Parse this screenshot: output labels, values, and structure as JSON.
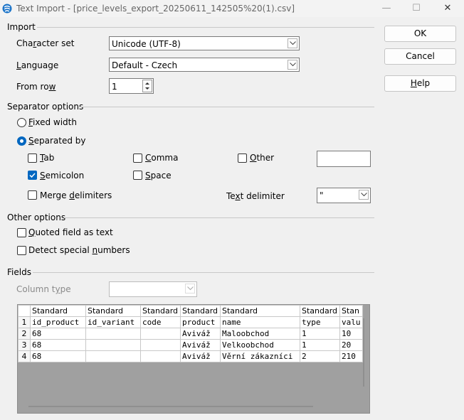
{
  "window": {
    "title": "Text Import - [price_levels_export_20250611_142505%20(1).csv]",
    "minimize": "—",
    "maximize": "☐",
    "close": "✕"
  },
  "import": {
    "section": "Import",
    "charset_label": "Character set",
    "charset_value": "Unicode (UTF-8)",
    "language_label": "Language",
    "language_value": "Default - Czech",
    "from_row_label": "From row",
    "from_row_value": "1"
  },
  "separator": {
    "section": "Separator options",
    "fixed_width": "Fixed width",
    "separated_by": "Separated by",
    "tab": "Tab",
    "comma": "Comma",
    "other": "Other",
    "semicolon": "Semicolon",
    "space": "Space",
    "merge": "Merge delimiters",
    "text_delim_label": "Text delimiter",
    "text_delim_value": "\""
  },
  "other_options": {
    "section": "Other options",
    "quoted": "Quoted field as text",
    "detect": "Detect special numbers"
  },
  "fields": {
    "section": "Fields",
    "column_type_label": "Column type",
    "column_type_value": ""
  },
  "buttons": {
    "ok": "OK",
    "cancel": "Cancel",
    "help": "Help"
  },
  "preview": {
    "headers": [
      "Standard",
      "Standard",
      "Standard",
      "Standard",
      "Standard",
      "Standard",
      "Stan"
    ],
    "rows": [
      {
        "n": "1",
        "cells": [
          "id_product",
          "id_variant",
          "code",
          "product",
          "name",
          "type",
          "valu"
        ]
      },
      {
        "n": "2",
        "cells": [
          "68",
          "",
          "",
          "Aviváž",
          "Maloobchod",
          "1",
          "10"
        ]
      },
      {
        "n": "3",
        "cells": [
          "68",
          "",
          "",
          "Aviváž",
          "Velkoobchod",
          "1",
          "20"
        ]
      },
      {
        "n": "4",
        "cells": [
          "68",
          "",
          "",
          "Aviváž",
          "Věrní zákazníci",
          "2",
          "210"
        ]
      }
    ]
  },
  "state": {
    "separated_by_selected": true,
    "semicolon_checked": true,
    "accent_color": "#0067c0"
  }
}
